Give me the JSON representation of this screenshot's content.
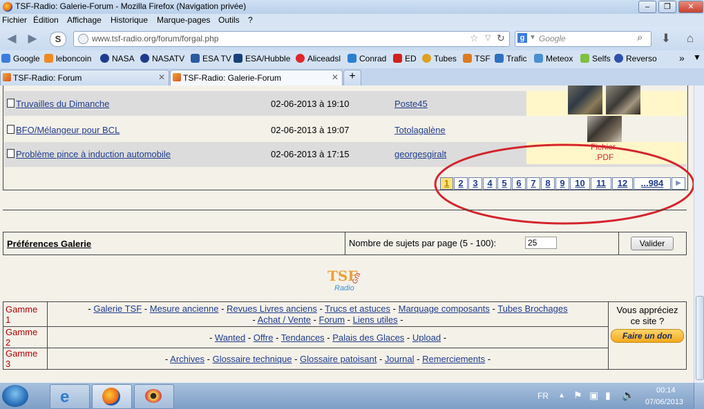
{
  "window": {
    "title": "TSF-Radio: Galerie-Forum - Mozilla Firefox (Navigation privée)"
  },
  "menu": [
    "Fichier",
    "Édition",
    "Affichage",
    "Historique",
    "Marque-pages",
    "Outils",
    "?"
  ],
  "nav": {
    "url": "www.tsf-radio.org/forum/forgal.php",
    "search_placeholder": "Google"
  },
  "bookmarks": [
    {
      "label": "Google",
      "color": "#3b7be0"
    },
    {
      "label": "leboncoin",
      "color": "#f08a24"
    },
    {
      "label": "NASA",
      "color": "#1f3c8c"
    },
    {
      "label": "NASATV",
      "color": "#1f3c8c"
    },
    {
      "label": "ESA TV",
      "color": "#2a5aa0"
    },
    {
      "label": "ESA/Hubble",
      "color": "#1a3f7a"
    },
    {
      "label": "Aliceadsl",
      "color": "#e0262a"
    },
    {
      "label": "Conrad",
      "color": "#2a7fd0"
    },
    {
      "label": "ED",
      "color": "#d02020"
    },
    {
      "label": "Tubes",
      "color": "#e0a020"
    },
    {
      "label": "TSF",
      "color": "#e07a20"
    },
    {
      "label": "Trafic",
      "color": "#3070c0"
    },
    {
      "label": "Meteox",
      "color": "#4a90d0"
    },
    {
      "label": "Selfs",
      "color": "#7fc040"
    },
    {
      "label": "Reverso",
      "color": "#3050b0"
    }
  ],
  "tabs": [
    {
      "label": "TSF-Radio: Forum"
    },
    {
      "label": "TSF-Radio: Galerie-Forum"
    }
  ],
  "topics": [
    {
      "title": "Truvailles du Dimanche",
      "date": "02-06-2013 à 19:10",
      "author": "Poste45"
    },
    {
      "title": "BFO/Mélangeur pour BCL",
      "date": "02-06-2013 à 19:07",
      "author": "Totolagalène"
    },
    {
      "title": "Problème pince à induction automobile",
      "date": "02-06-2013 à 17:15",
      "author": "georgesgiralt"
    }
  ],
  "pdf_label_1": "Fichier",
  "pdf_label_2": ".PDF",
  "pagination": [
    "1",
    "2",
    "3",
    "4",
    "5",
    "6",
    "7",
    "8",
    "9",
    "10",
    "11",
    "12",
    "...984"
  ],
  "prefs": {
    "title": "Préférences Galerie",
    "label": "Nombre de sujets par page (5 - 100):",
    "value": "25",
    "button": "Valider"
  },
  "logo": {
    "line1": "TSF",
    "line2": "Radio",
    "line3": "Gra"
  },
  "gammes": [
    {
      "label": "Gamme 1",
      "links_line1": [
        "Galerie TSF",
        "Mesure ancienne",
        "Revues Livres anciens",
        "Trucs et astuces",
        "Marquage composants",
        "Tubes Brochages"
      ],
      "links_line2": [
        "Achat / Vente",
        "Forum",
        "Liens utiles"
      ]
    },
    {
      "label": "Gamme 2",
      "links": [
        "Wanted",
        "Offre",
        "Tendances",
        "Palais des Glaces",
        "Upload"
      ]
    },
    {
      "label": "Gamme 3",
      "links": [
        "Archives",
        "Glossaire technique",
        "Glossaire patoisant",
        "Journal",
        "Remerciements"
      ]
    }
  ],
  "donate": {
    "text": "Vous appréciez ce site ?",
    "button": "Faire un don"
  },
  "taskbar": {
    "lang": "FR",
    "time": "00:14",
    "date": "07/06/2013"
  },
  "colors": {
    "row_alt": "#dcdcdc",
    "thumb_bg": "#fff7c9",
    "link": "#1f3c8c",
    "gamme_label": "#b00000",
    "highlight_circle": "#d4242b"
  }
}
